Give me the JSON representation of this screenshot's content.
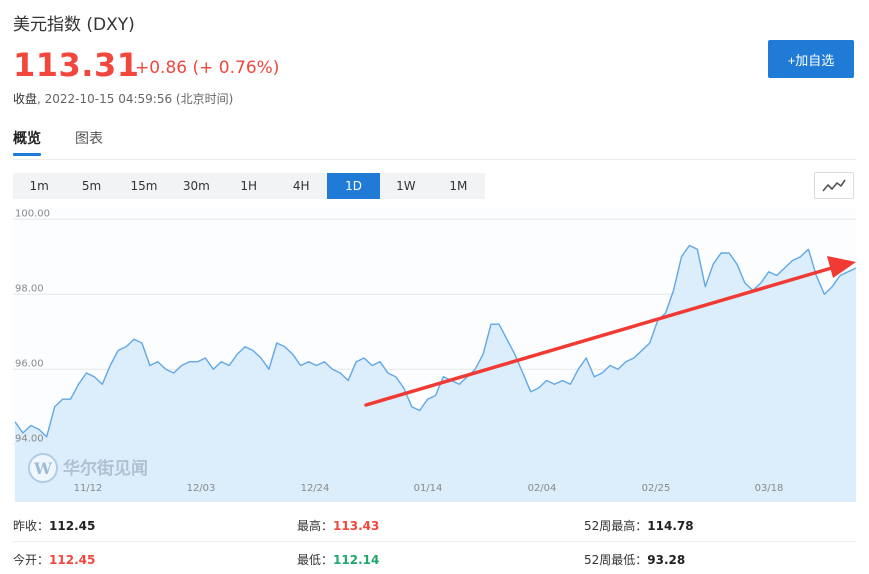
{
  "quote": {
    "title": "美元指数 (DXY)",
    "price": "113.31",
    "change": "+0.86 (+ 0.76%)",
    "status": "收盘",
    "timestamp": ", 2022-10-15 04:59:56 (北京时间)",
    "watch_label": "+加自选"
  },
  "tabs": [
    {
      "label": "概览",
      "active": true
    },
    {
      "label": "图表",
      "active": false
    }
  ],
  "periods": [
    {
      "label": "1m",
      "active": false
    },
    {
      "label": "5m",
      "active": false
    },
    {
      "label": "15m",
      "active": false
    },
    {
      "label": "30m",
      "active": false
    },
    {
      "label": "1H",
      "active": false
    },
    {
      "label": "4H",
      "active": false
    },
    {
      "label": "1D",
      "active": true
    },
    {
      "label": "1W",
      "active": false
    },
    {
      "label": "1M",
      "active": false
    }
  ],
  "chart_type_icon": "line-chart-icon",
  "chart_data": {
    "type": "area",
    "y_ticks": [
      "100.00",
      "98.00",
      "96.00",
      "94.00"
    ],
    "x_ticks": [
      "11/12",
      "12/03",
      "12/24",
      "01/14",
      "02/04",
      "02/25",
      "03/18"
    ],
    "ylim": [
      93.1,
      100.3
    ],
    "values": [
      94.6,
      94.3,
      94.5,
      94.4,
      94.2,
      95.0,
      95.2,
      95.2,
      95.6,
      95.9,
      95.8,
      95.6,
      96.1,
      96.5,
      96.6,
      96.8,
      96.7,
      96.1,
      96.2,
      96.0,
      95.9,
      96.1,
      96.2,
      96.2,
      96.3,
      96.0,
      96.2,
      96.1,
      96.4,
      96.6,
      96.5,
      96.3,
      96.0,
      96.7,
      96.6,
      96.4,
      96.1,
      96.2,
      96.1,
      96.2,
      96.0,
      95.9,
      95.7,
      96.2,
      96.3,
      96.1,
      96.2,
      95.9,
      95.8,
      95.5,
      95.0,
      94.9,
      95.2,
      95.3,
      95.8,
      95.7,
      95.6,
      95.8,
      96.0,
      96.4,
      97.2,
      97.2,
      96.8,
      96.4,
      95.9,
      95.4,
      95.5,
      95.7,
      95.6,
      95.7,
      95.6,
      96.0,
      96.3,
      95.8,
      95.9,
      96.1,
      96.0,
      96.2,
      96.3,
      96.5,
      96.7,
      97.3,
      97.5,
      98.1,
      99.0,
      99.3,
      99.2,
      98.2,
      98.8,
      99.1,
      99.1,
      98.8,
      98.3,
      98.1,
      98.3,
      98.6,
      98.5,
      98.7,
      98.9,
      99.0,
      99.2,
      98.5,
      98.0,
      98.2,
      98.5,
      98.6,
      98.7
    ],
    "series_color": "#62a8e6",
    "fill_color": "#dcedfb",
    "arrow_color": "#f13a33"
  },
  "watermark": {
    "logo_letter": "W",
    "text": "华尔街见闻"
  },
  "stats": [
    [
      {
        "label": "昨收：",
        "value": "112.45",
        "color": "dark"
      },
      {
        "label": "最高：",
        "value": "113.43",
        "color": "red"
      },
      {
        "label": "52周最高：",
        "value": "114.78",
        "color": "dark"
      }
    ],
    [
      {
        "label": "今开：",
        "value": "112.45",
        "color": "red"
      },
      {
        "label": "最低：",
        "value": "112.14",
        "color": "green"
      },
      {
        "label": "52周最低：",
        "value": "93.28",
        "color": "dark"
      }
    ]
  ]
}
